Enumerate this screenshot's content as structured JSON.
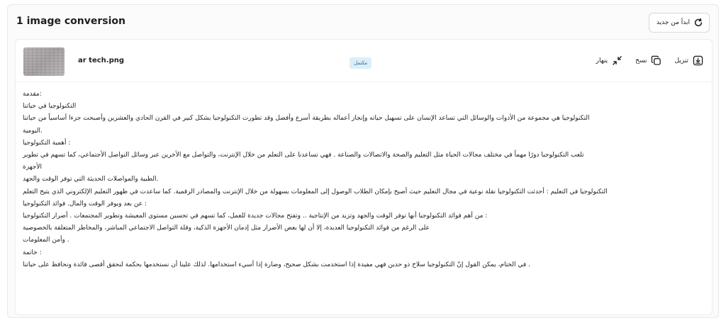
{
  "panel": {
    "title": "1 image conversion",
    "restart_label": "ابدأ من جديد"
  },
  "file": {
    "name": "ar tech.png",
    "status": "مكتمل",
    "actions": {
      "download": "تنزيل",
      "copy": "نسخ",
      "expand": "ينهار"
    }
  },
  "content": {
    "lines": [
      ":مقدمة",
      "التكنولوجيا في حياتنا",
      "التكنولوجيا هي مجموعة من الأدوات والوسائل التي تساعد الإنسان على تسهيل حياته وإنجاز أعماله بطريقة أسرع وأفضل وقد تطورت التكنولوجيا بشكل كبير في القرن الحادي والعشرين وأصبحت جزءا أساسياً من حياتنا",
      ".اليومية",
      ": أهمية التكنولوجيا",
      "تلعب التكنولوجيا دورًا مهماً في مختلف مجالات الحياة مثل التعليم والصحة والاتصالات والصناعة . فهي تساعدنا على التعلم من خلال الإنترنت، والتواصل مع الأخرين عبر وسائل التواصل الأجتماعي، كما تسهم في تطوير",
      "الأجهزة",
      ".الطبية والمواصلات الحديثة التي توفر الوقت والجهد",
      "التكنولوجيا في التعليم : أحدثت التكنولوجيا نقلة نوعية في مجال التعليم حيث أصبح بإمكان الطلاب الوصول إلى المعلومات بسهولة من خلال الإنترنت والمصادر الرقمية. كما ساعدت في ظهور التعليم الإلكتروني الذي يتيح التعلم",
      ": عن بعد ويوفر الوقت والمال. فوائد التكنولوجيا",
      ": من أهم فوائد التكنولوجيا أنها توفر الوقت والجهد وتزيد من الإنتاجية .. وتفتح مجالات جديدة للعمل، كما تسهم في تحسين مستوى المعيشة وتطوير المجتمعات . أضرار التكنولوجيا",
      "على الرغم من فوائد التكنولوجيا العديدة، إلا أن لها بعض الأضرار مثل إدمان الأجهزة الذكية، وقلة التواصل الاجتماعي المباشر، والمخاطر المتعلقة بالخصوصية",
      ". وأمن المعلومات",
      ": خاتمة",
      ". في الختام، يمكن القول إنّ التكنولوجيا سلاح ذو حدين فهي مفيدة إذا استخدمت بشكل صحيح، وضارة إذا أسيء استخدامها. لذلك علينا أن نستخدمها بحكمة لنحقق أقصى فائدة ونحافظ على حياتنا"
    ]
  },
  "icons": {
    "restart": "refresh-icon",
    "download": "download-icon",
    "copy": "copy-icon",
    "expand": "collapse-arrows-icon"
  },
  "colors": {
    "badge_bg": "#dceef9",
    "badge_text": "#2a6c96"
  }
}
